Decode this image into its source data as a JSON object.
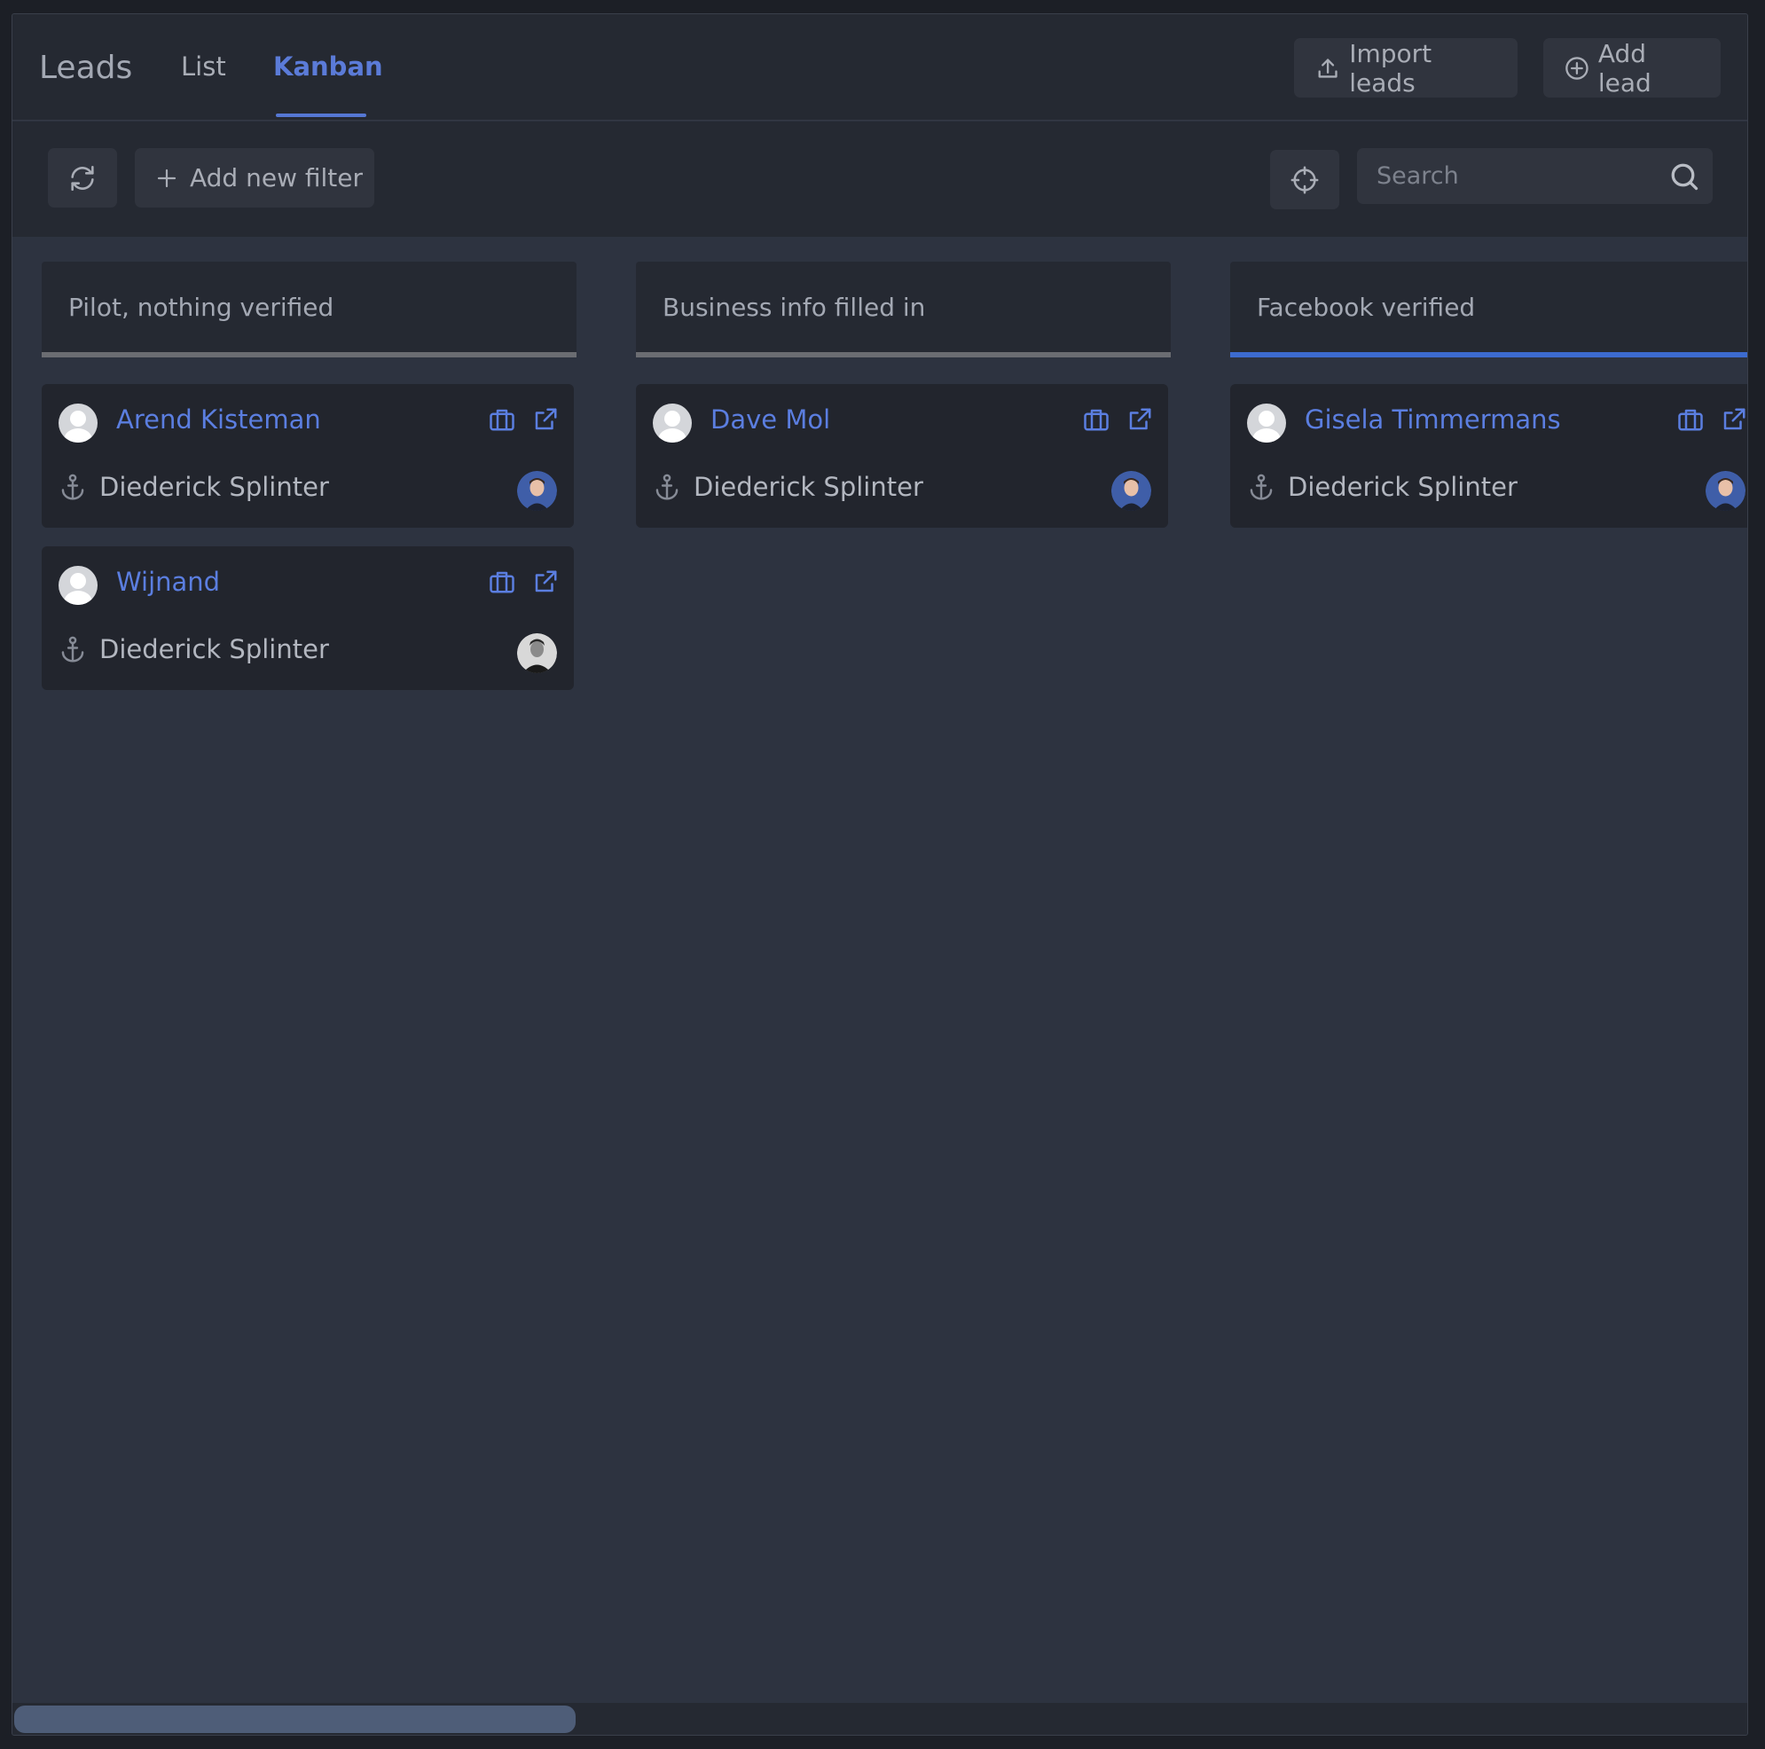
{
  "header": {
    "title": "Leads",
    "tabs": [
      {
        "label": "List",
        "active": false
      },
      {
        "label": "Kanban",
        "active": true
      }
    ],
    "import_label": "Import leads",
    "add_label": "Add lead"
  },
  "toolbar": {
    "add_filter_label": "Add new filter",
    "search_placeholder": "Search"
  },
  "colors": {
    "accent": "#5b7ee0",
    "background": "#2d3340",
    "panel": "#252932",
    "card": "#22252d"
  },
  "columns": [
    {
      "title": "Pilot, nothing verified",
      "cards": [
        {
          "name": "Arend Kisteman",
          "owner": "Diederick Splinter",
          "owner_avatar": "blue-portrait"
        },
        {
          "name": "Wijnand",
          "owner": "Diederick Splinter",
          "owner_avatar": "mono-portrait"
        }
      ]
    },
    {
      "title": "Business info filled in",
      "cards": [
        {
          "name": "Dave Mol",
          "owner": "Diederick Splinter",
          "owner_avatar": "blue-portrait"
        }
      ]
    },
    {
      "title": "Facebook verified",
      "cards": [
        {
          "name": "Gisela Timmermans",
          "owner": "Diederick Splinter",
          "owner_avatar": "blue-portrait"
        }
      ]
    }
  ],
  "icons": {
    "refresh": "refresh-icon",
    "plus": "plus-icon",
    "target": "crosshair-icon",
    "search": "search-icon",
    "upload": "upload-icon",
    "add_circle": "plus-circle-icon",
    "briefcase": "briefcase-icon",
    "external": "external-link-icon",
    "anchor": "anchor-icon"
  }
}
